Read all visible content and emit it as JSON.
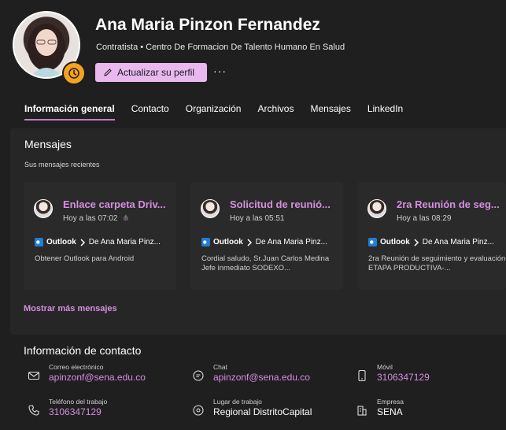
{
  "profile": {
    "name": "Ana Maria Pinzon Fernandez",
    "subtitle": "Contratista • Centro De Formacion De Talento Humano En Salud",
    "update_button": "Actualizar su perfil",
    "more_button": "···"
  },
  "tabs": [
    {
      "label": "Información general",
      "active": true
    },
    {
      "label": "Contacto"
    },
    {
      "label": "Organización"
    },
    {
      "label": "Archivos"
    },
    {
      "label": "Mensajes"
    },
    {
      "label": "LinkedIn"
    }
  ],
  "messages": {
    "title": "Mensajes",
    "subtitle": "Sus mensajes recientes",
    "show_more": "Mostrar más mensajes",
    "items": [
      {
        "title": "Enlace carpeta Driv...",
        "time": "Hoy a las 07:02",
        "source_app": "Outlook",
        "source_detail": "De Ana Maria Pinz...",
        "preview": "Obtener Outlook para Android"
      },
      {
        "title": "Solicitud de reunió...",
        "time": "Hoy a las 05:51",
        "source_app": "Outlook",
        "source_detail": "De Ana Maria Pinz...",
        "preview": "Cordial saludo, Sr.Juan Carlos Medina Jefe inmediato SODEXO..."
      },
      {
        "title": "2ra Reunión de seg...",
        "time": "Hoy a las 08:29",
        "source_app": "Outlook",
        "source_detail": "De Ana Maria Pinz...",
        "preview": "2ra Reunión de seguimiento y evaluación-ETAPA PRODUCTIVA-..."
      }
    ]
  },
  "contact": {
    "title": "Información de contacto",
    "items": [
      {
        "icon": "mail-icon",
        "label": "Correo electrónico",
        "value": "apinzonf@sena.edu.co"
      },
      {
        "icon": "chat-icon",
        "label": "Chat",
        "value": "apinzonf@sena.edu.co"
      },
      {
        "icon": "mobile-icon",
        "label": "Móvil",
        "value": "3106347129"
      },
      {
        "icon": "phone-icon",
        "label": "Teléfono del trabajo",
        "value": "3106347129"
      },
      {
        "icon": "location-icon",
        "label": "Lugar de trabajo",
        "value": "Regional DistritoCapital"
      },
      {
        "icon": "building-icon",
        "label": "Empresa",
        "value": "SENA"
      }
    ]
  },
  "colors": {
    "accent": "#c27ec9",
    "link": "#d58ee0",
    "button_bg": "#e8b8ee",
    "status_badge": "#f6a21e"
  }
}
